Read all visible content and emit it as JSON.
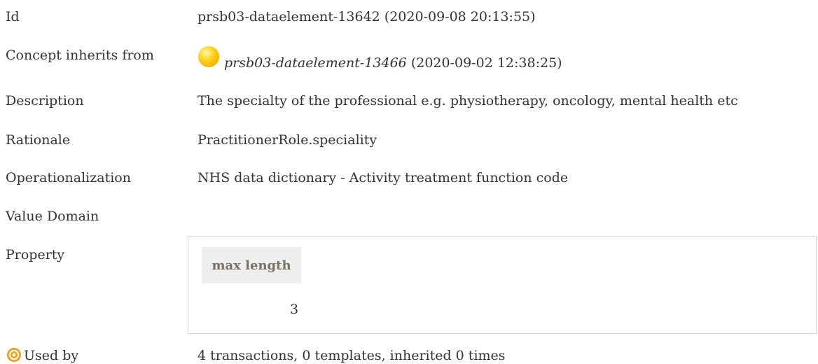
{
  "rows": {
    "id": {
      "label": "Id",
      "value": "prsb03-dataelement-13642 (2020-09-08 20:13:55)"
    },
    "inherits": {
      "label": "Concept inherits from",
      "ref": "prsb03-dataelement-13466",
      "date": " (2020-09-02 12:38:25)",
      "status_color": "#ffd21a",
      "icon": "status-ball-icon"
    },
    "description": {
      "label": "Description",
      "value": "The specialty of the professional e.g. physiotherapy, oncology, mental health etc"
    },
    "rationale": {
      "label": "Rationale",
      "value": "PractitionerRole.speciality"
    },
    "operationalization": {
      "label": "Operationalization",
      "value": "NHS data dictionary - Activity treatment function code"
    },
    "value_domain": {
      "label": "Value Domain"
    },
    "property": {
      "label": "Property",
      "header": "max length",
      "value": "3"
    },
    "used_by": {
      "label": "Used by",
      "value": "4 transactions, 0 templates, inherited 0 times",
      "icon": "target-icon"
    }
  }
}
